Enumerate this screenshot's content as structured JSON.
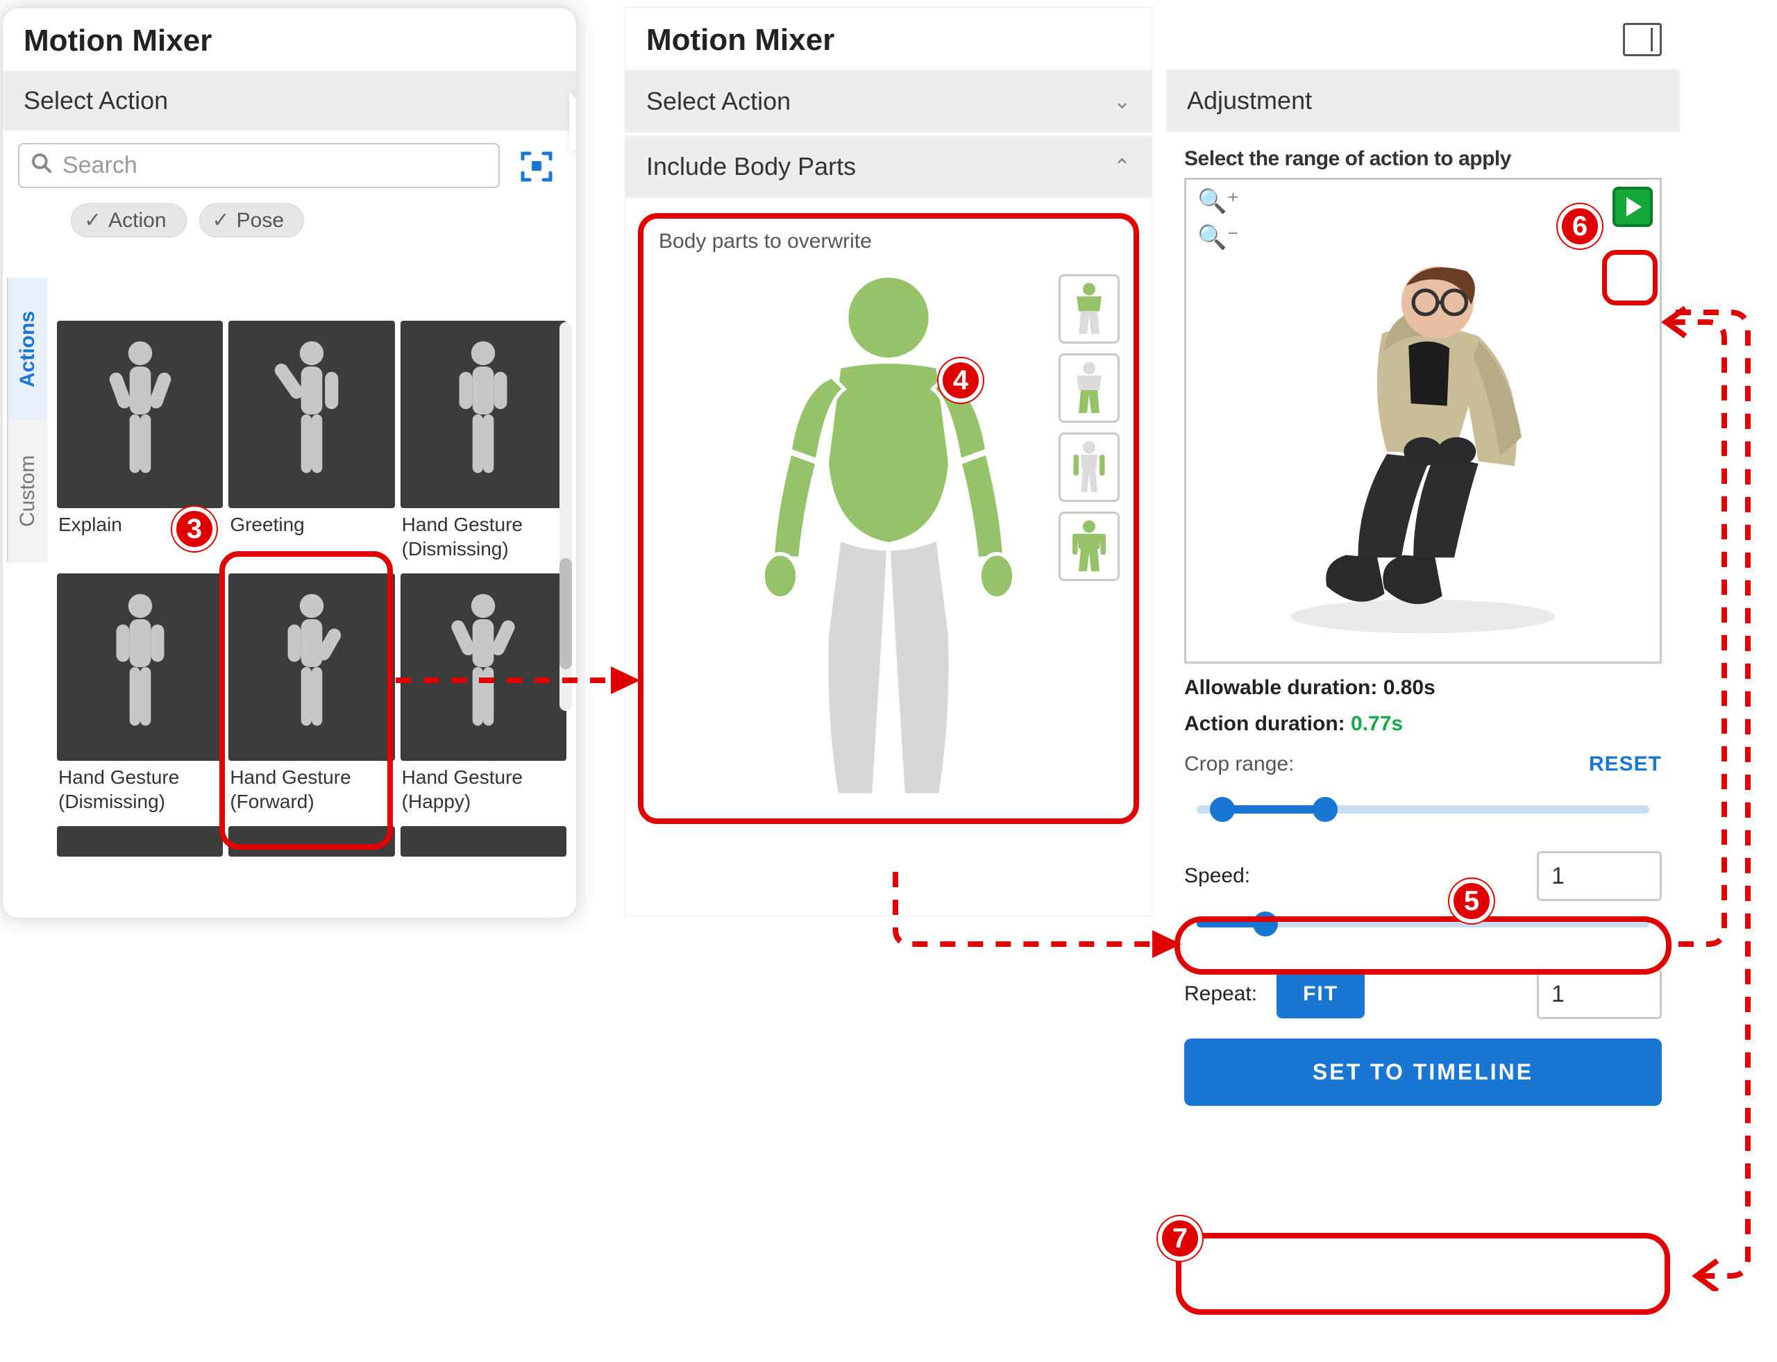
{
  "colors": {
    "accent": "#1976d2",
    "danger": "#e00000",
    "ok": "#17a948",
    "body_active": "#96c26a"
  },
  "left": {
    "title": "Motion Mixer",
    "section": "Select Action",
    "search_placeholder": "Search",
    "chips": {
      "action": "Action",
      "pose": "Pose"
    },
    "tabs": {
      "actions": "Actions",
      "custom": "Custom"
    },
    "thumbs": [
      {
        "label": "Explain"
      },
      {
        "label": "Greeting"
      },
      {
        "label": "Hand Gesture (Dismissing)"
      },
      {
        "label": "Hand Gesture (Dismissing)"
      },
      {
        "label": "Hand Gesture (Forward)"
      },
      {
        "label": "Hand Gesture (Happy)"
      }
    ]
  },
  "mid": {
    "title": "Motion Mixer",
    "select_action": "Select Action",
    "include": "Include Body Parts",
    "hint": "Body parts to overwrite",
    "presets": [
      "upper",
      "lower",
      "arms",
      "full"
    ]
  },
  "right": {
    "adjustment": "Adjustment",
    "hint": "Select the range of action to apply",
    "allowable_label": "Allowable duration:",
    "allowable_value": "0.80s",
    "action_label": "Action duration:",
    "action_value": "0.77s",
    "crop_label": "Crop range:",
    "reset": "RESET",
    "speed_label": "Speed:",
    "speed_value": "1",
    "repeat_label": "Repeat:",
    "fit": "FIT",
    "repeat_value": "1",
    "set_btn": "SET TO TIMELINE",
    "crop_range": {
      "start_pct": 6,
      "end_pct": 30
    },
    "speed_pct": 16
  },
  "steps": {
    "s3": "3",
    "s4": "4",
    "s5": "5",
    "s6": "6",
    "s7": "7"
  }
}
